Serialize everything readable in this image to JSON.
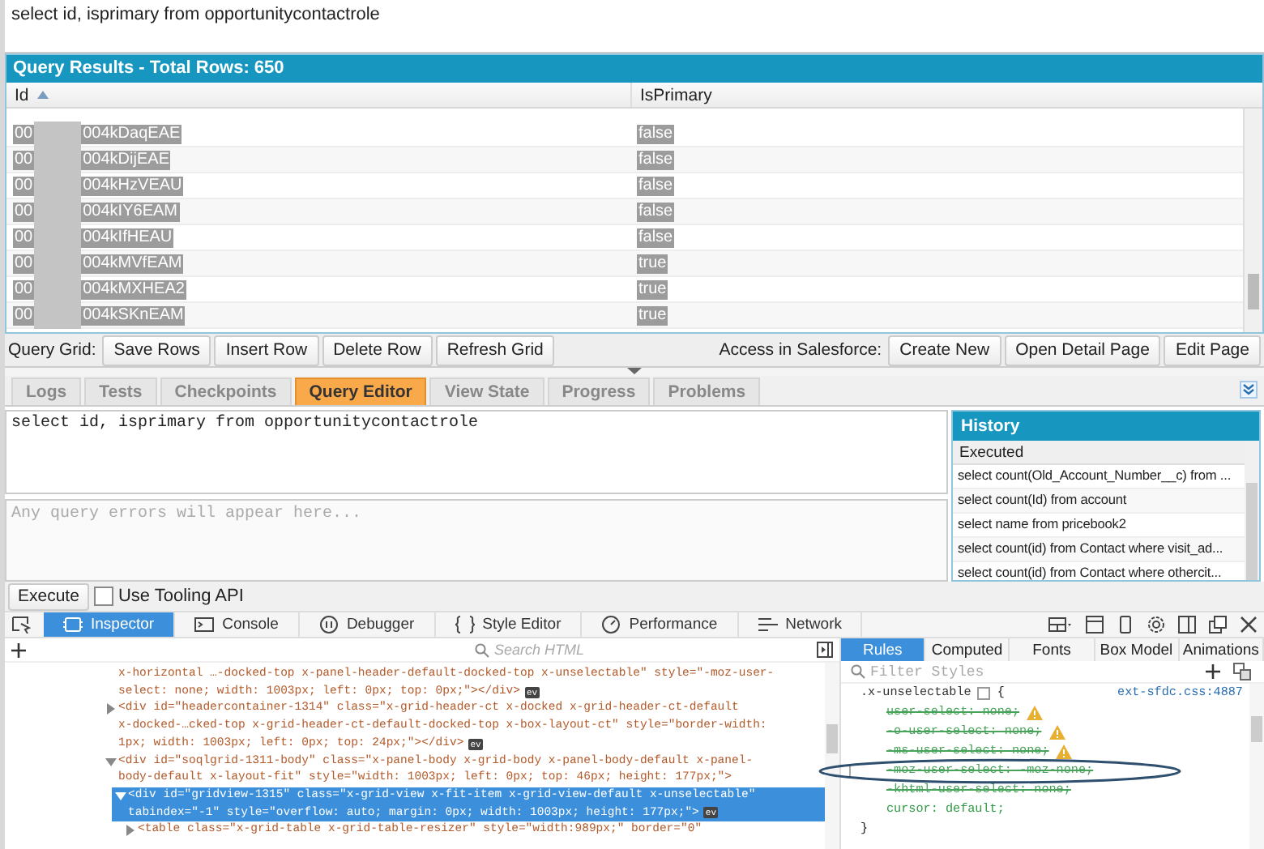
{
  "query_input": {
    "value": "select id, isprimary from opportunitycontactrole"
  },
  "results": {
    "title": "Query Results - Total Rows: 650",
    "columns": [
      {
        "label": "Id",
        "sorted": true
      },
      {
        "label": "IsPrimary",
        "sorted": false
      }
    ],
    "rows": [
      {
        "id_start": "00",
        "id_end": "004kDaqEAE",
        "redacted": true,
        "isprimary": "false"
      },
      {
        "id_start": "00",
        "id_end": "004kDijEAE",
        "redacted": true,
        "isprimary": "false"
      },
      {
        "id_start": "00",
        "id_end": "004kHzVEAU",
        "redacted": true,
        "isprimary": "false"
      },
      {
        "id_start": "00",
        "id_end": "004kIY6EAM",
        "redacted": true,
        "isprimary": "false"
      },
      {
        "id_start": "00",
        "id_end": "004kIfHEAU",
        "redacted": true,
        "isprimary": "false"
      },
      {
        "id_start": "00",
        "id_end": "004kMVfEAM",
        "redacted": true,
        "isprimary": "true"
      },
      {
        "id_start": "00",
        "id_end": "004kMXHEA2",
        "redacted": true,
        "isprimary": "true"
      },
      {
        "id_start": "00",
        "id_end": "004kSKnEAM",
        "redacted": true,
        "isprimary": "true"
      }
    ]
  },
  "grid_toolbar": {
    "label": "Query Grid:",
    "buttons": [
      "Save Rows",
      "Insert Row",
      "Delete Row",
      "Refresh Grid"
    ],
    "access_label": "Access in Salesforce:",
    "access_buttons": [
      "Create New",
      "Open Detail Page",
      "Edit Page"
    ]
  },
  "tabs": [
    {
      "label": "Logs",
      "selected": false
    },
    {
      "label": "Tests",
      "selected": false
    },
    {
      "label": "Checkpoints",
      "selected": false
    },
    {
      "label": "Query Editor",
      "selected": true
    },
    {
      "label": "View State",
      "selected": false
    },
    {
      "label": "Progress",
      "selected": false
    },
    {
      "label": "Problems",
      "selected": false
    }
  ],
  "editor": {
    "value": "select id, isprimary from opportunitycontactrole"
  },
  "errors": {
    "placeholder": "Any query errors will appear here..."
  },
  "history": {
    "title": "History",
    "column": "Executed",
    "items": [
      "select count(Old_Account_Number__c) from ...",
      "select count(Id) from account",
      "select name from pricebook2",
      "select count(id) from Contact where visit_ad...",
      "select count(id) from Contact where othercit..."
    ]
  },
  "execute": {
    "button": "Execute",
    "tooling": {
      "label": "Use Tooling API",
      "checked": false
    }
  },
  "devtools": {
    "tabs": [
      {
        "label": "Inspector",
        "kind": "inspector",
        "selected": true
      },
      {
        "label": "Console",
        "kind": "console",
        "selected": false
      },
      {
        "label": "Debugger",
        "kind": "debugger",
        "selected": false
      },
      {
        "label": "Style Editor",
        "kind": "style",
        "selected": false
      },
      {
        "label": "Performance",
        "kind": "performance",
        "selected": false
      },
      {
        "label": "Network",
        "kind": "network",
        "selected": false
      }
    ],
    "search_placeholder": "Search HTML",
    "markup": [
      {
        "kind": "tail",
        "lines": [
          "x-horizontal …-docked-top x-panel-header-default-docked-top x-unselectable\" style=\"-moz-user-",
          "select: none; width: 1003px; left: 0px; top: 0px;\"></div>"
        ],
        "badge": "ev",
        "selected": false
      },
      {
        "kind": "node",
        "expanded": false,
        "lines": [
          "<div id=\"headercontainer-1314\" class=\"x-grid-header-ct x-docked x-grid-header-ct-default",
          "x-docked-…cked-top x-grid-header-ct-default-docked-top x-box-layout-ct\" style=\"border-width:",
          "1px; width: 1003px; left: 0px; top: 24px;\"></div>"
        ],
        "badge": "ev",
        "selected": false
      },
      {
        "kind": "node",
        "expanded": true,
        "lines": [
          "<div id=\"soqlgrid-1311-body\" class=\"x-panel-body x-grid-body x-panel-body-default x-panel-",
          "body-default x-layout-fit\" style=\"width: 1003px; left: 0px; top: 46px; height: 177px;\">"
        ],
        "selected": false,
        "children": [
          {
            "kind": "node",
            "expanded": true,
            "lines": [
              "<div id=\"gridview-1315\" class=\"x-grid-view x-fit-item x-grid-view-default x-unselectable\"",
              "tabindex=\"-1\" style=\"overflow: auto; margin: 0px; width: 1003px; height: 177px;\">"
            ],
            "badge": "ev",
            "selected": true,
            "children": [
              {
                "kind": "node",
                "expanded": false,
                "lines": [
                  "<table class=\"x-grid-table x-grid-table-resizer\" style=\"width:989px;\" border=\"0\""
                ],
                "selected": false
              }
            ]
          }
        ]
      }
    ],
    "rules_tabs": [
      {
        "label": "Rules",
        "selected": true
      },
      {
        "label": "Computed",
        "selected": false
      },
      {
        "label": "Fonts",
        "selected": false
      },
      {
        "label": "Box Model",
        "selected": false
      },
      {
        "label": "Animations",
        "selected": false
      }
    ],
    "filter_placeholder": "Filter Styles",
    "rule": {
      "selector": ".x-unselectable",
      "open": "{",
      "source": "ext-sfdc.css:4887",
      "close": "}",
      "declarations": [
        {
          "kind": "plain",
          "text": "user-select: none;",
          "overridden": true,
          "warning": true
        },
        {
          "kind": "plain",
          "text": "-o-user-select: none;",
          "overridden": true,
          "warning": true
        },
        {
          "kind": "plain",
          "text": "-ms-user-select: none;",
          "overridden": true,
          "warning": true
        },
        {
          "kind": "hovered",
          "text": "-moz-user-select: -moz-none;",
          "overridden": true,
          "warning": false
        },
        {
          "kind": "plain",
          "text": "-khtml-user-select: none;",
          "overridden": true,
          "warning": false
        },
        {
          "kind": "plain",
          "text": "cursor: default;",
          "overridden": false,
          "warning": false
        }
      ]
    },
    "annotations": [
      {
        "kind": "ellipse"
      }
    ]
  }
}
